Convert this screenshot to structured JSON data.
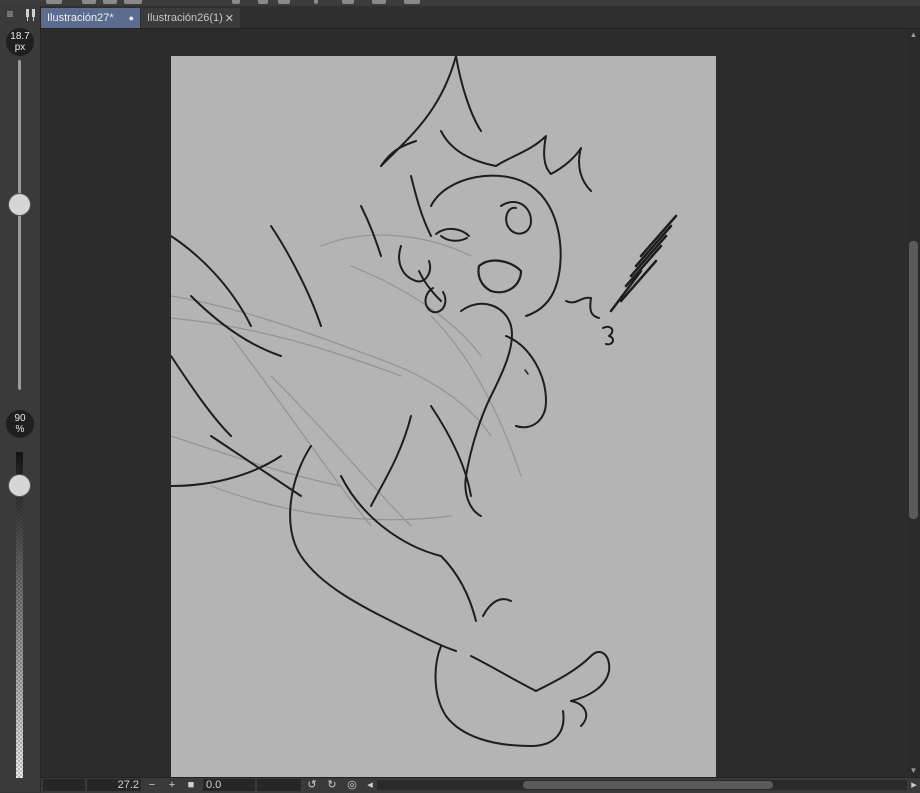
{
  "tabs": [
    {
      "label": "Ilustración27*",
      "state": "active",
      "marker": "●"
    },
    {
      "label": "Ilustración26(1)",
      "state": "inactive",
      "marker": "✕"
    }
  ],
  "brush_panel": {
    "size_value": "18.7",
    "size_unit": "px",
    "opacity_value": "90",
    "opacity_unit": "%",
    "menu_icon": "hamburger-menu-icon",
    "pin_icon": "pin-icon",
    "size_level": 0.2,
    "opacity_level": 0.9
  },
  "status": {
    "zoom": "27.2",
    "rotation": "0.0"
  },
  "colors": {
    "active_tab": "#5b6c8f",
    "paper": "#b4b4b4",
    "workspace": "#2c2c2c"
  }
}
